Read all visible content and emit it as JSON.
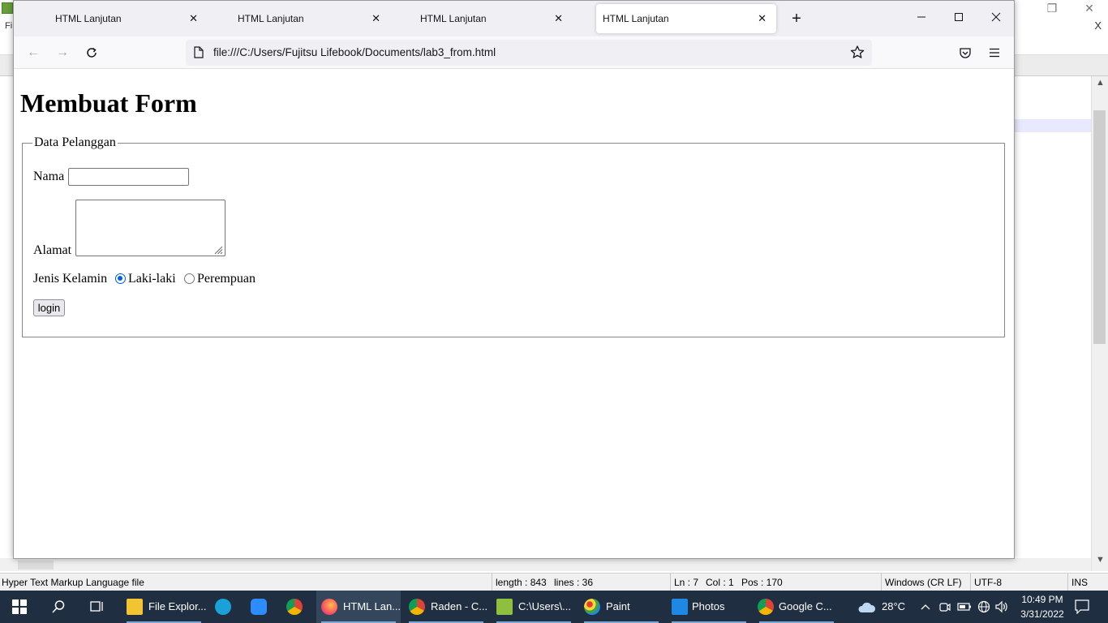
{
  "background_editor": {
    "x_label": "X",
    "status_bar": {
      "file_type": "Hyper Text Markup Language file",
      "length": "length : 843",
      "lines": "lines : 36",
      "ln": "Ln : 7",
      "col": "Col : 1",
      "pos": "Pos : 170",
      "eol": "Windows (CR LF)",
      "encoding": "UTF-8",
      "mode": "INS"
    }
  },
  "browser": {
    "tabs": [
      {
        "label": "HTML Lanjutan",
        "active": false
      },
      {
        "label": "HTML Lanjutan",
        "active": false
      },
      {
        "label": "HTML Lanjutan",
        "active": false
      },
      {
        "label": "HTML Lanjutan",
        "active": true
      }
    ],
    "url": "file:///C:/Users/Fujitsu Lifebook/Documents/lab3_from.html"
  },
  "page": {
    "heading": "Membuat Form",
    "legend": "Data Pelanggan",
    "nama_label": "Nama",
    "nama_value": "",
    "alamat_label": "Alamat",
    "alamat_value": "",
    "jenis_kelamin_label": "Jenis Kelamin",
    "radio_options": [
      {
        "label": "Laki-laki",
        "checked": true
      },
      {
        "label": "Perempuan",
        "checked": false
      }
    ],
    "submit_label": "login"
  },
  "taskbar": {
    "items": [
      {
        "label": "File Explor..."
      },
      {
        "label": "HTML Lan..."
      },
      {
        "label": "Raden - C..."
      },
      {
        "label": "C:\\Users\\..."
      },
      {
        "label": "Paint"
      },
      {
        "label": "Photos"
      },
      {
        "label": "Google C..."
      }
    ],
    "weather": "28°C",
    "time": "10:49 PM",
    "date": "3/31/2022"
  }
}
